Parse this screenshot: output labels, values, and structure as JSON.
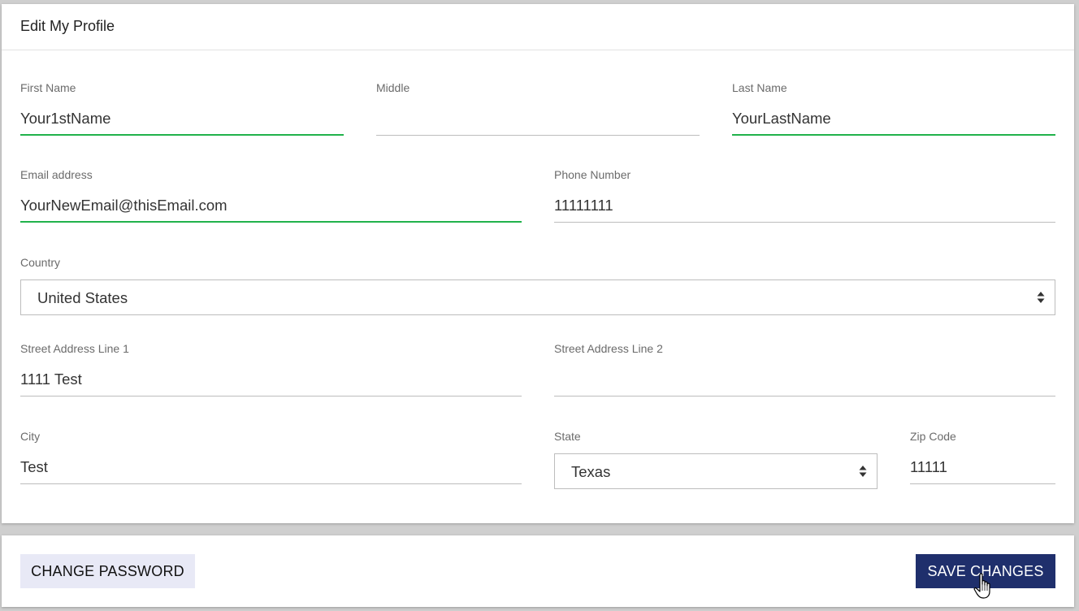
{
  "header": {
    "title": "Edit My Profile"
  },
  "form": {
    "first_name": {
      "label": "First Name",
      "value": "Your1stName"
    },
    "middle": {
      "label": "Middle",
      "value": ""
    },
    "last_name": {
      "label": "Last Name",
      "value": "YourLastName"
    },
    "email": {
      "label": "Email address",
      "value": "YourNewEmail@thisEmail.com"
    },
    "phone": {
      "label": "Phone Number",
      "value": "11111111"
    },
    "country": {
      "label": "Country",
      "value": "United States"
    },
    "street1": {
      "label": "Street Address Line 1",
      "value": "1111 Test"
    },
    "street2": {
      "label": "Street Address Line 2",
      "value": ""
    },
    "city": {
      "label": "City",
      "value": "Test"
    },
    "state": {
      "label": "State",
      "value": "Texas"
    },
    "zip": {
      "label": "Zip Code",
      "value": "11111"
    }
  },
  "footer": {
    "change_password_label": "CHANGE PASSWORD",
    "save_changes_label": "SAVE CHANGES"
  },
  "colors": {
    "valid_underline": "#21b24b",
    "primary_button": "#1f2f6c",
    "secondary_button": "#e8e9f6"
  },
  "icons": {
    "select_arrows": "sort-arrows-icon",
    "cursor": "hand-pointer-icon"
  }
}
